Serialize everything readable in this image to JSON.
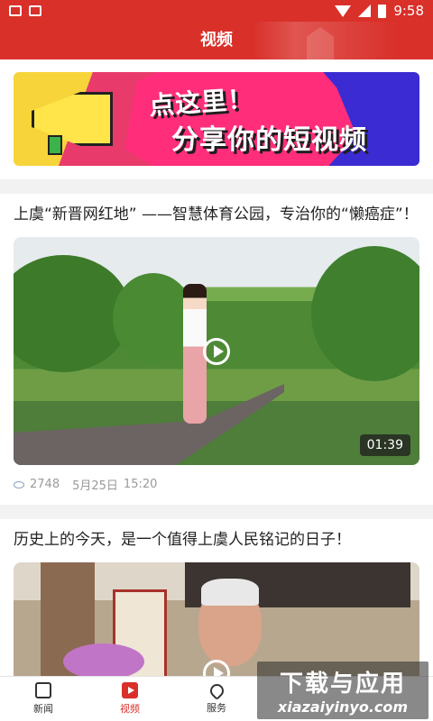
{
  "status_bar": {
    "time": "9:58"
  },
  "header": {
    "title": "视频"
  },
  "banner": {
    "line1": "点这里！",
    "line2": "分享你的短视频"
  },
  "news": [
    {
      "title": "上虞“新晋网红地” ——智慧体育公园，专治你的“懒癌症”！",
      "duration": "01:39",
      "views": "2748",
      "date": "5月25日",
      "time": "15:20"
    },
    {
      "title": "历史上的今天，是一个值得上虞人民铭记的日子！"
    }
  ],
  "tabbar": {
    "items": [
      {
        "label": "新闻",
        "icon": "news-icon"
      },
      {
        "label": "视频",
        "icon": "video-icon"
      },
      {
        "label": "服务",
        "icon": "service-icon"
      }
    ]
  },
  "watermark": {
    "main": "下载与应用",
    "sub": "xiazaiyinyo.com"
  },
  "colors": {
    "brand": "#d9302a"
  }
}
